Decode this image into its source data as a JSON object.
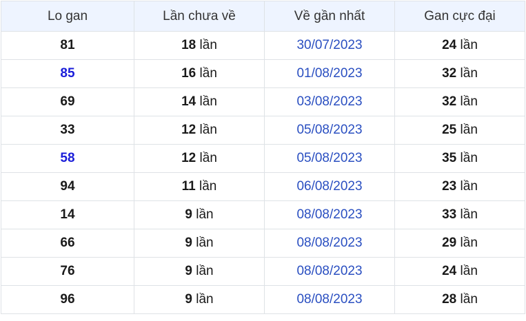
{
  "colors": {
    "header_bg": "#eef4ff",
    "highlight_number": "#1a1dd9",
    "date_text": "#2a4fc1",
    "border": "#dee2e6"
  },
  "table": {
    "headers": [
      "Lo gan",
      "Lần chưa về",
      "Về gần nhất",
      "Gan cực đại"
    ],
    "unit": "lần",
    "rows": [
      {
        "lo": "81",
        "highlight": false,
        "missed": "18",
        "last_date": "30/07/2023",
        "max_gan": "24"
      },
      {
        "lo": "85",
        "highlight": true,
        "missed": "16",
        "last_date": "01/08/2023",
        "max_gan": "32"
      },
      {
        "lo": "69",
        "highlight": false,
        "missed": "14",
        "last_date": "03/08/2023",
        "max_gan": "32"
      },
      {
        "lo": "33",
        "highlight": false,
        "missed": "12",
        "last_date": "05/08/2023",
        "max_gan": "25"
      },
      {
        "lo": "58",
        "highlight": true,
        "missed": "12",
        "last_date": "05/08/2023",
        "max_gan": "35"
      },
      {
        "lo": "94",
        "highlight": false,
        "missed": "11",
        "last_date": "06/08/2023",
        "max_gan": "23"
      },
      {
        "lo": "14",
        "highlight": false,
        "missed": "9",
        "last_date": "08/08/2023",
        "max_gan": "33"
      },
      {
        "lo": "66",
        "highlight": false,
        "missed": "9",
        "last_date": "08/08/2023",
        "max_gan": "29"
      },
      {
        "lo": "76",
        "highlight": false,
        "missed": "9",
        "last_date": "08/08/2023",
        "max_gan": "24"
      },
      {
        "lo": "96",
        "highlight": false,
        "missed": "9",
        "last_date": "08/08/2023",
        "max_gan": "28"
      }
    ]
  }
}
